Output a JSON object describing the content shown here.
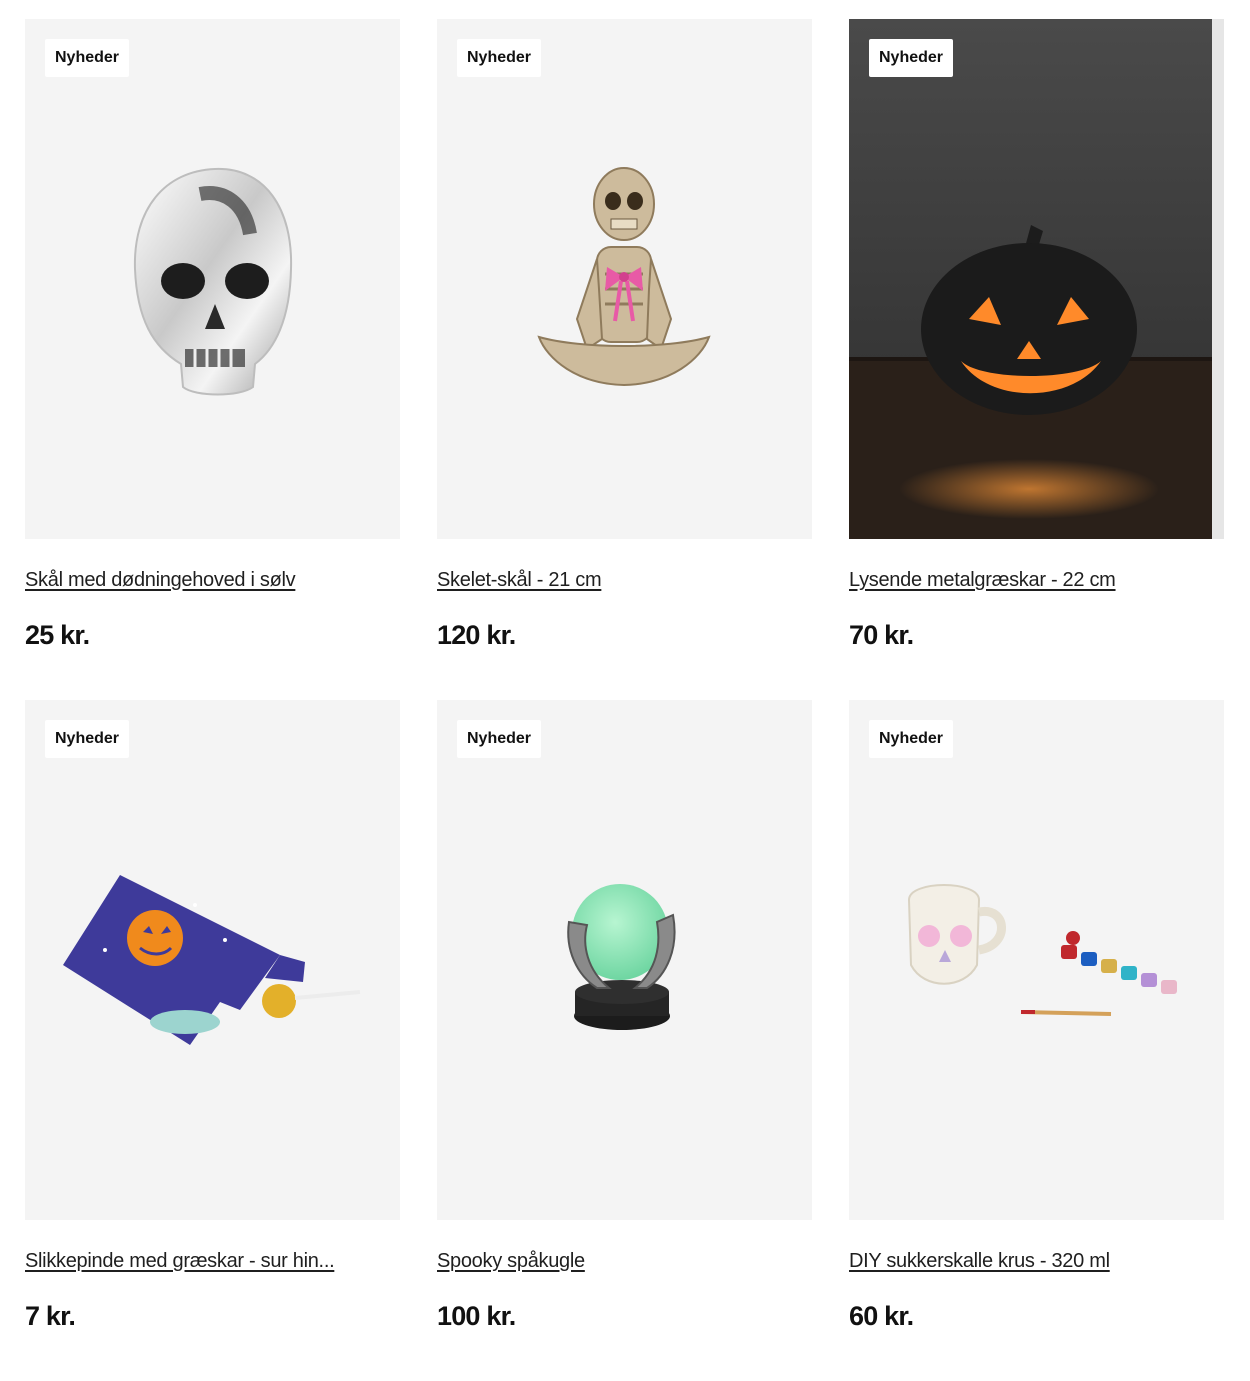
{
  "products": [
    {
      "badge": "Nyheder",
      "title": "Skål med dødningehoved i sølv",
      "price": "25 kr.",
      "image": "silver-skull-bowl"
    },
    {
      "badge": "Nyheder",
      "title": "Skelet-skål - 21 cm",
      "price": "120 kr.",
      "image": "skeleton-bowl"
    },
    {
      "badge": "Nyheder",
      "title": "Lysende metalgræskar - 22 cm",
      "price": "70 kr.",
      "image": "glowing-pumpkin"
    },
    {
      "badge": "Nyheder",
      "title": "Slikkepinde med græskar - sur hin...",
      "price": "7 kr.",
      "image": "pumpkin-lollipop-pack"
    },
    {
      "badge": "Nyheder",
      "title": "Spooky spåkugle",
      "price": "100 kr.",
      "image": "crystal-ball-hands"
    },
    {
      "badge": "Nyheder",
      "title": "DIY sukkerskalle krus - 320 ml",
      "price": "60 kr.",
      "image": "sugar-skull-mug-kit"
    }
  ],
  "colors": {
    "card_bg": "#f4f4f4",
    "badge_bg": "#ffffff",
    "text": "#1a1a1a",
    "pumpkin_glow": "#ff8a2a"
  }
}
